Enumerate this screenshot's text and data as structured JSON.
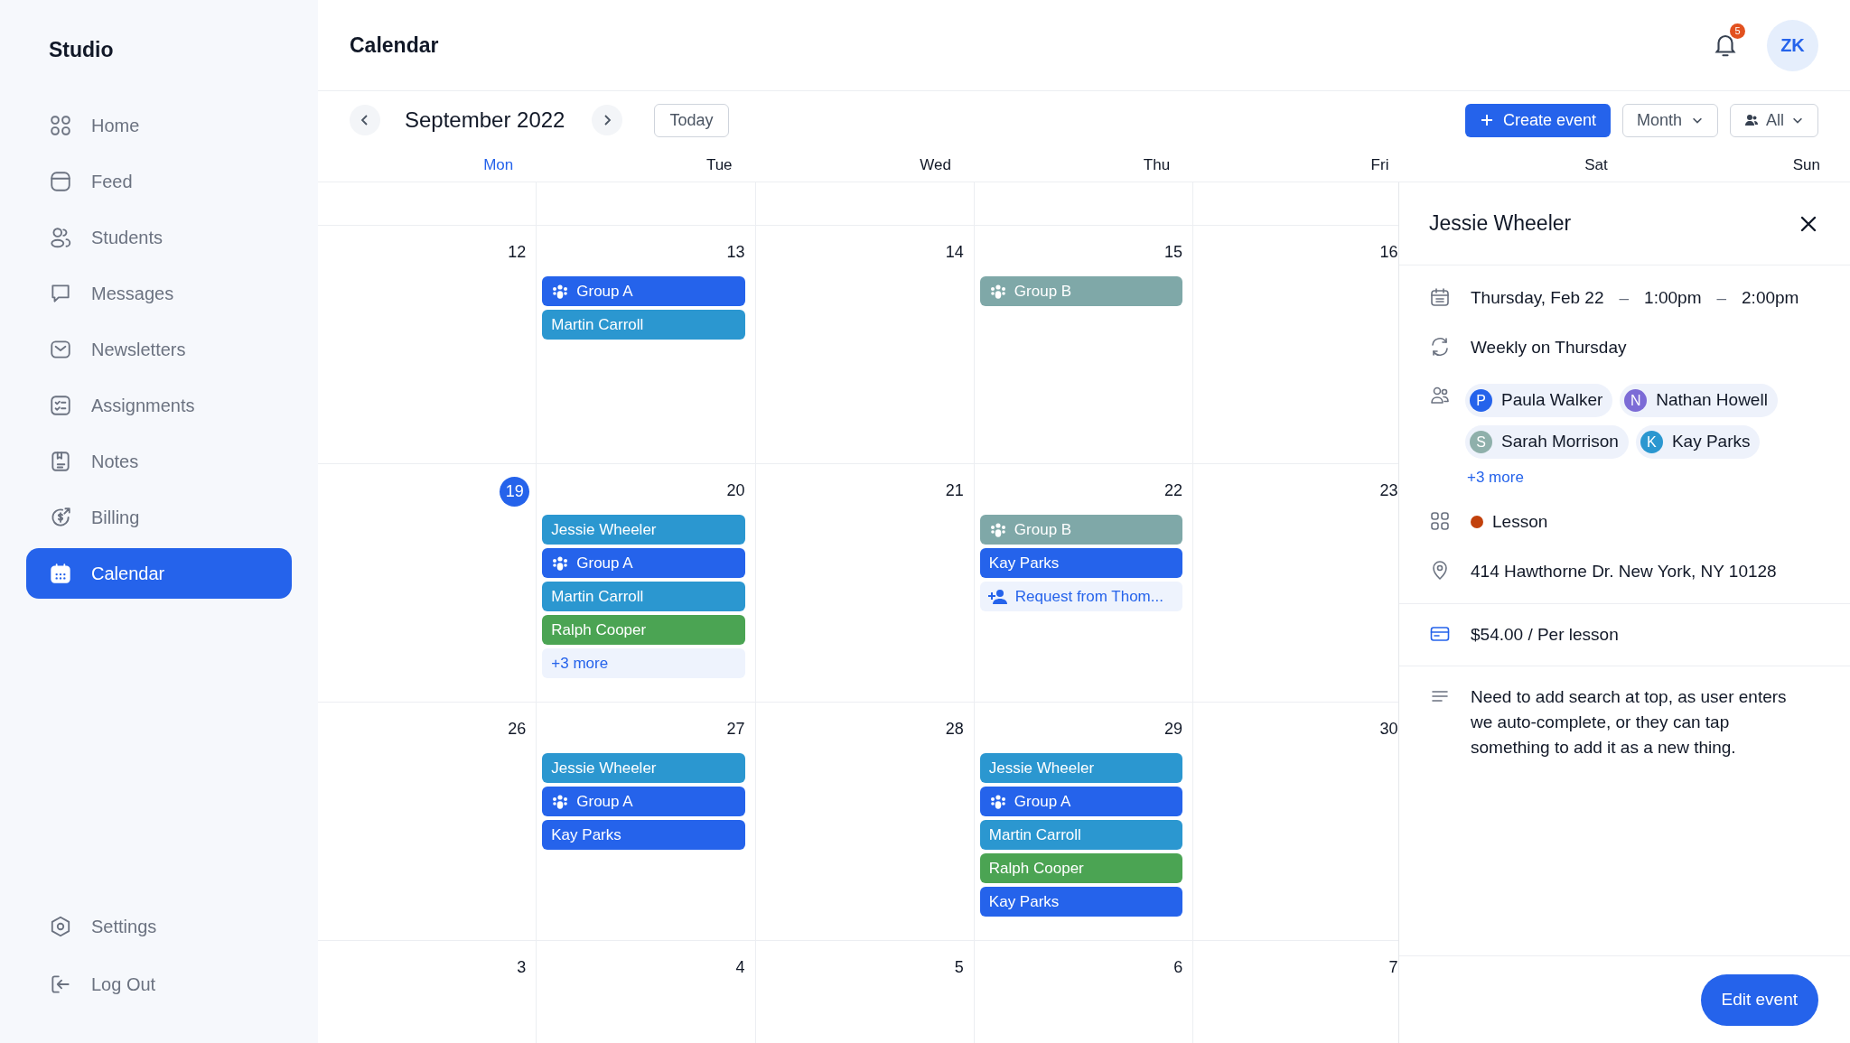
{
  "sidebar": {
    "brand": "Studio",
    "items": [
      {
        "label": "Home",
        "selected": false
      },
      {
        "label": "Feed",
        "selected": false
      },
      {
        "label": "Students",
        "selected": false
      },
      {
        "label": "Messages",
        "selected": false
      },
      {
        "label": "Newsletters",
        "selected": false
      },
      {
        "label": "Assignments",
        "selected": false
      },
      {
        "label": "Notes",
        "selected": false
      },
      {
        "label": "Billing",
        "selected": false
      },
      {
        "label": "Calendar",
        "selected": true
      }
    ],
    "footer_items": [
      {
        "label": "Settings"
      },
      {
        "label": "Log Out"
      }
    ]
  },
  "header": {
    "title": "Calendar",
    "notification_count": "5",
    "avatar_initials": "ZK"
  },
  "toolbar": {
    "month_label": "September 2022",
    "today_button": "Today",
    "create_button": "Create event",
    "view_select": "Month",
    "filter_select": "All"
  },
  "weekdays": [
    {
      "label": "Mon",
      "current": true
    },
    {
      "label": "Tue",
      "current": false
    },
    {
      "label": "Wed",
      "current": false
    },
    {
      "label": "Thu",
      "current": false
    },
    {
      "label": "Fri",
      "current": false
    },
    {
      "label": "Sat",
      "current": false
    },
    {
      "label": "Sun",
      "current": false
    }
  ],
  "weeks": [
    {
      "days": [
        {
          "number": "12",
          "today": false
        },
        {
          "number": "13",
          "today": false,
          "events": [
            {
              "title": "Group A",
              "kind": "group",
              "color": "#2563eb"
            },
            {
              "title": "Martin Carroll",
              "kind": "person",
              "color": "#2b97d0"
            }
          ]
        },
        {
          "number": "14",
          "today": false
        },
        {
          "number": "15",
          "today": false,
          "events": [
            {
              "title": "Group B",
              "kind": "group",
              "color": "#7fa8a8"
            }
          ]
        },
        {
          "number": "16",
          "today": false
        }
      ]
    },
    {
      "days": [
        {
          "number": "19",
          "today": true
        },
        {
          "number": "20",
          "today": false,
          "events": [
            {
              "title": "Jessie Wheeler",
              "kind": "person",
              "color": "#2b97d0"
            },
            {
              "title": "Group A",
              "kind": "group",
              "color": "#2563eb"
            },
            {
              "title": "Martin Carroll",
              "kind": "person",
              "color": "#2b97d0"
            },
            {
              "title": "Ralph Cooper",
              "kind": "person",
              "color": "#4ba453"
            },
            {
              "title": "+3 more",
              "kind": "more"
            }
          ]
        },
        {
          "number": "21",
          "today": false
        },
        {
          "number": "22",
          "today": false,
          "events": [
            {
              "title": "Group B",
              "kind": "group",
              "color": "#7fa8a8"
            },
            {
              "title": "Kay Parks",
              "kind": "person",
              "color": "#2563eb"
            },
            {
              "title": "Request from Thom...",
              "kind": "request",
              "color": "#2563eb"
            }
          ]
        },
        {
          "number": "23",
          "today": false
        }
      ]
    },
    {
      "days": [
        {
          "number": "26",
          "today": false
        },
        {
          "number": "27",
          "today": false,
          "events": [
            {
              "title": "Jessie Wheeler",
              "kind": "person",
              "color": "#2b97d0"
            },
            {
              "title": "Group A",
              "kind": "group",
              "color": "#2563eb"
            },
            {
              "title": "Kay Parks",
              "kind": "person",
              "color": "#2563eb"
            }
          ]
        },
        {
          "number": "28",
          "today": false
        },
        {
          "number": "29",
          "today": false,
          "events": [
            {
              "title": "Jessie Wheeler",
              "kind": "person",
              "color": "#2b97d0"
            },
            {
              "title": "Group A",
              "kind": "group",
              "color": "#2563eb"
            },
            {
              "title": "Martin Carroll",
              "kind": "person",
              "color": "#2b97d0"
            },
            {
              "title": "Ralph Cooper",
              "kind": "person",
              "color": "#4ba453"
            },
            {
              "title": "Kay Parks",
              "kind": "person",
              "color": "#2563eb"
            }
          ]
        },
        {
          "number": "30",
          "today": false
        }
      ]
    },
    {
      "days": [
        {
          "number": "3",
          "today": false
        },
        {
          "number": "4",
          "today": false
        },
        {
          "number": "5",
          "today": false
        },
        {
          "number": "6",
          "today": false
        },
        {
          "number": "7",
          "today": false
        }
      ]
    }
  ],
  "event_panel": {
    "title": "Jessie Wheeler",
    "when": [
      "Thursday, Feb 22",
      "–",
      "1:00pm",
      "–",
      "2:00pm"
    ],
    "recurrence": "Weekly on Thursday",
    "attendees": [
      {
        "initial": "P",
        "name": "Paula Walker",
        "color": "#2563eb"
      },
      {
        "initial": "N",
        "name": "Nathan Howell",
        "color": "#7c6bd6"
      },
      {
        "initial": "S",
        "name": "Sarah Morrison",
        "color": "#8fb0ab"
      },
      {
        "initial": "K",
        "name": "Kay Parks",
        "color": "#2b97d0"
      }
    ],
    "more_attendees": "+3 more",
    "category": {
      "label": "Lesson",
      "color": "#c2410c"
    },
    "address": "414 Hawthorne Dr. New York, NY 10128",
    "price": "$54.00 / Per lesson",
    "notes": "Need to add search at top, as user enters we auto-complete, or they can tap something to add it as a new thing.",
    "edit_button": "Edit event"
  }
}
